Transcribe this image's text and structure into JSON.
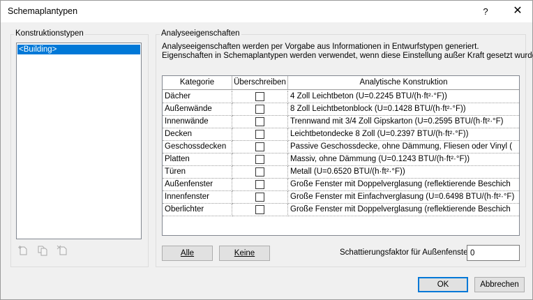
{
  "window": {
    "title": "Schemaplantypen",
    "help_label": "?",
    "close_label": "✕"
  },
  "construction_types": {
    "group_label": "Konstruktionstypen",
    "items": [
      "<Building>"
    ],
    "tool_icons": [
      "new-type-icon",
      "duplicate-type-icon",
      "delete-type-icon"
    ]
  },
  "analysis": {
    "group_label": "Analyseeigenschaften",
    "description_line1": "Analyseeigenschaften werden per Vorgabe aus Informationen in Entwurfstypen generiert.",
    "description_line2": "Eigenschaften in Schemaplantypen werden verwendet, wenn diese Einstellung außer Kraft gesetzt wurde.",
    "columns": [
      "Kategorie",
      "Überschreiben",
      "Analytische Konstruktion"
    ],
    "rows": [
      {
        "category": "Dächer",
        "override": false,
        "construction": "4 Zoll Leichtbeton (U=0.2245 BTU/(h·ft²·°F))"
      },
      {
        "category": "Außenwände",
        "override": false,
        "construction": "8 Zoll Leichtbetonblock (U=0.1428 BTU/(h·ft²·°F))"
      },
      {
        "category": "Innenwände",
        "override": false,
        "construction": "Trennwand mit 3/4 Zoll Gipskarton (U=0.2595 BTU/(h·ft²·°F)"
      },
      {
        "category": "Decken",
        "override": false,
        "construction": "Leichtbetondecke 8 Zoll (U=0.2397 BTU/(h·ft²·°F))"
      },
      {
        "category": "Geschossdecken",
        "override": false,
        "construction": "Passive Geschossdecke, ohne Dämmung, Fliesen oder Vinyl ("
      },
      {
        "category": "Platten",
        "override": false,
        "construction": "Massiv, ohne Dämmung (U=0.1243 BTU/(h·ft²·°F))"
      },
      {
        "category": "Türen",
        "override": false,
        "construction": "Metall (U=0.6520 BTU/(h·ft²·°F))"
      },
      {
        "category": "Außenfenster",
        "override": false,
        "construction": "Große Fenster mit Doppelverglasung (reflektierende Beschich"
      },
      {
        "category": "Innenfenster",
        "override": false,
        "construction": "Große Fenster mit Einfachverglasung (U=0.6498 BTU/(h·ft²·°F)"
      },
      {
        "category": "Oberlichter",
        "override": false,
        "construction": "Große Fenster mit Doppelverglasung (reflektierende Beschich"
      }
    ],
    "select_all_button": "Alle",
    "select_none_button": "Keine",
    "shading_label": "Schattierungsfaktor für Außenfenster:",
    "shading_value": "0"
  },
  "footer": {
    "ok_button": "OK",
    "cancel_button": "Abbrechen"
  }
}
